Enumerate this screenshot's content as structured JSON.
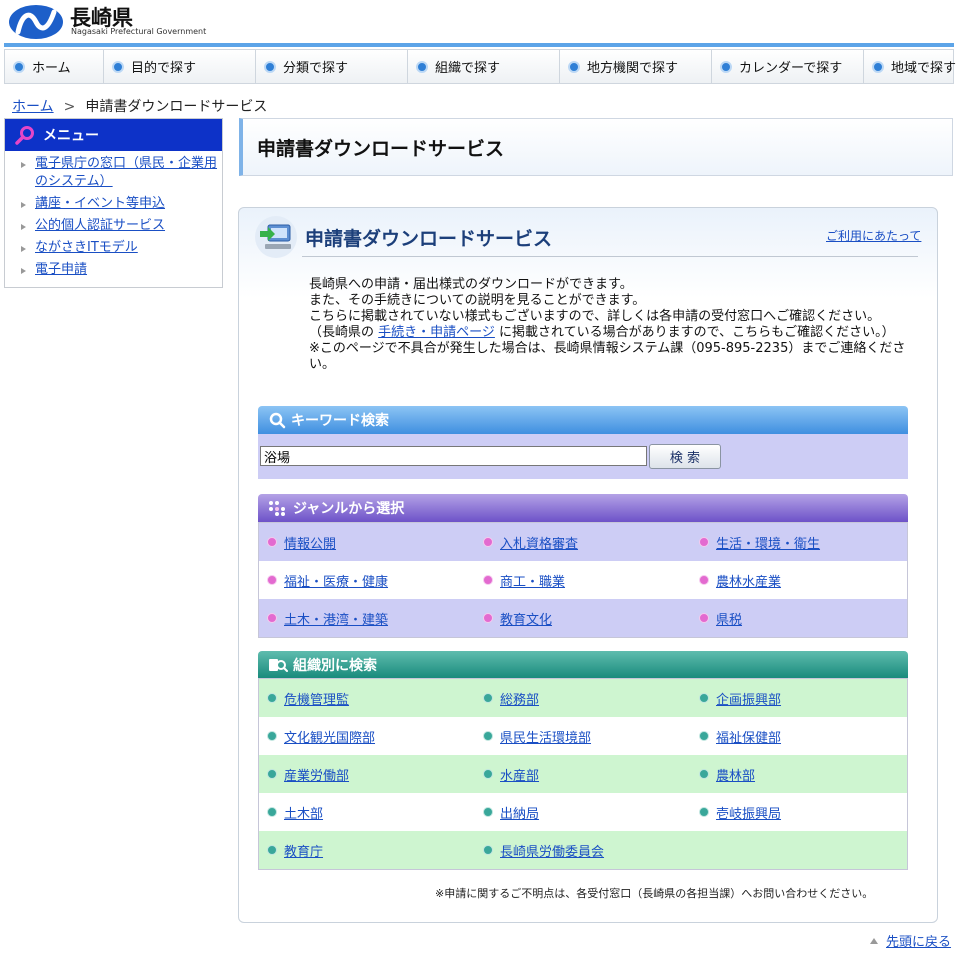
{
  "header": {
    "logo_jp": "長崎県",
    "logo_en": "Nagasaki Prefectural Government"
  },
  "gnav": [
    {
      "label": "ホーム"
    },
    {
      "label": "目的で探す"
    },
    {
      "label": "分類で探す"
    },
    {
      "label": "組織で探す"
    },
    {
      "label": "地方機関で探す"
    },
    {
      "label": "カレンダーで探す"
    },
    {
      "label": "地域で探す"
    }
  ],
  "breadcrumb": {
    "home": "ホーム",
    "separator": ">",
    "current": "申請書ダウンロードサービス"
  },
  "sidebar": {
    "title": "メニュー",
    "items": [
      {
        "label": "電子県庁の窓口（県民・企業用のシステム）"
      },
      {
        "label": "講座・イベント等申込"
      },
      {
        "label": "公的個人認証サービス"
      },
      {
        "label": "ながさきITモデル"
      },
      {
        "label": "電子申請"
      }
    ]
  },
  "page": {
    "title": "申請書ダウンロードサービス"
  },
  "content": {
    "title": "申請書ダウンロードサービス",
    "usage_link": "ご利用にあたって",
    "desc": {
      "line1": "長崎県への申請・届出様式のダウンロードができます。",
      "line2": "また、その手続きについての説明を見ることができます。",
      "line3": "こちらに掲載されていない様式もございますので、詳しくは各申請の受付窓口へご確認ください。",
      "line4_pre": "（長崎県の",
      "line4_link": "手続き・申請ページ",
      "line4_post": "に掲載されている場合がありますので、こちらもご確認ください。）",
      "line5": "※このページで不具合が発生した場合は、長崎県情報システム課（095-895-2235）までご連絡ください。"
    },
    "keyword": {
      "title": "キーワード検索",
      "value": "浴場",
      "button": "検 索"
    },
    "genre": {
      "title": "ジャンルから選択",
      "rows": [
        [
          "情報公開",
          "入札資格審査",
          "生活・環境・衛生"
        ],
        [
          "福祉・医療・健康",
          "商工・職業",
          "農林水産業"
        ],
        [
          "土木・港湾・建築",
          "教育文化",
          "県税"
        ]
      ]
    },
    "org": {
      "title": "組織別に検索",
      "rows": [
        [
          "危機管理監",
          "総務部",
          "企画振興部"
        ],
        [
          "文化観光国際部",
          "県民生活環境部",
          "福祉保健部"
        ],
        [
          "産業労働部",
          "水産部",
          "農林部"
        ],
        [
          "土木部",
          "出納局",
          "壱岐振興局"
        ],
        [
          "教育庁",
          "長崎県労働委員会",
          ""
        ]
      ]
    },
    "note": "※申請に関するご不明点は、各受付窓口（長崎県の各担当課）へお問い合わせください。"
  },
  "footer": {
    "to_top": "先頭に戻る"
  },
  "colors": {
    "menu_head": "#0d32c8",
    "keyword_head": "#3f8fe0",
    "genre_head": "#6d52c8",
    "genre_row": "#cdcdf5",
    "org_head": "#16897a",
    "org_row": "#cef5d0",
    "link": "#1a4fc4"
  }
}
